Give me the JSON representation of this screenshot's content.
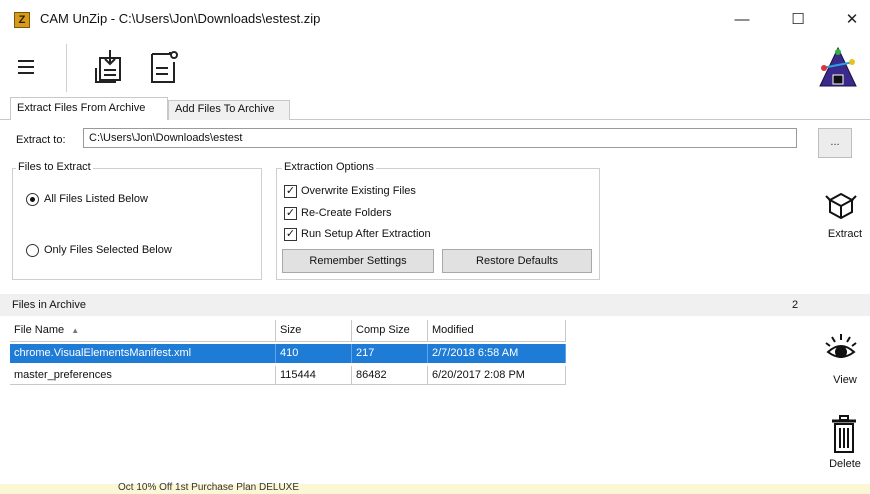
{
  "window": {
    "title": "CAM UnZip - C:\\Users\\Jon\\Downloads\\estest.zip",
    "app_icon_letter": "Z",
    "minimize_glyph": "—",
    "maximize_glyph": "☐",
    "close_glyph": "✕"
  },
  "toolbar": {
    "menu_icon": "hamburger-menu-icon",
    "extract_doc_icon": "document-extract-icon",
    "new_doc_icon": "new-document-icon",
    "logo_icon": "triangle-logo-icon"
  },
  "tabs": [
    {
      "label": "Extract Files From Archive",
      "active": true
    },
    {
      "label": "Add Files To Archive",
      "active": false
    }
  ],
  "extract": {
    "label": "Extract to:",
    "path": "C:\\Users\\Jon\\Downloads\\estest",
    "browse_label": "..."
  },
  "files_to_extract": {
    "title": "Files to Extract",
    "options": [
      {
        "label": "All Files Listed Below",
        "selected": true
      },
      {
        "label": "Only Files Selected Below",
        "selected": false
      }
    ]
  },
  "extraction_options": {
    "title": "Extraction Options",
    "checkboxes": [
      {
        "label": "Overwrite Existing Files",
        "checked": true
      },
      {
        "label": "Re-Create Folders",
        "checked": true
      },
      {
        "label": "Run Setup After Extraction",
        "checked": true
      }
    ],
    "remember_label": "Remember Settings",
    "restore_label": "Restore Defaults"
  },
  "side_actions": {
    "extract_label": "Extract",
    "view_label": "View",
    "delete_label": "Delete"
  },
  "files_in_archive": {
    "title": "Files in Archive",
    "count": "2",
    "columns": [
      "File Name",
      "Size",
      "Comp Size",
      "Modified"
    ],
    "sort_indicator": "▲",
    "rows": [
      {
        "name": "chrome.VisualElementsManifest.xml",
        "size": "410",
        "comp": "217",
        "modified": "2/7/2018 6:58 AM",
        "selected": true
      },
      {
        "name": "master_preferences",
        "size": "115444",
        "comp": "86482",
        "modified": "6/20/2017 2:08 PM",
        "selected": false
      }
    ]
  },
  "status": {
    "text": "Oct 10% Off 1st Purchase Plan DELUXE"
  },
  "colors": {
    "selection": "#1e7bd6",
    "status_bg": "#fbf6d4"
  }
}
